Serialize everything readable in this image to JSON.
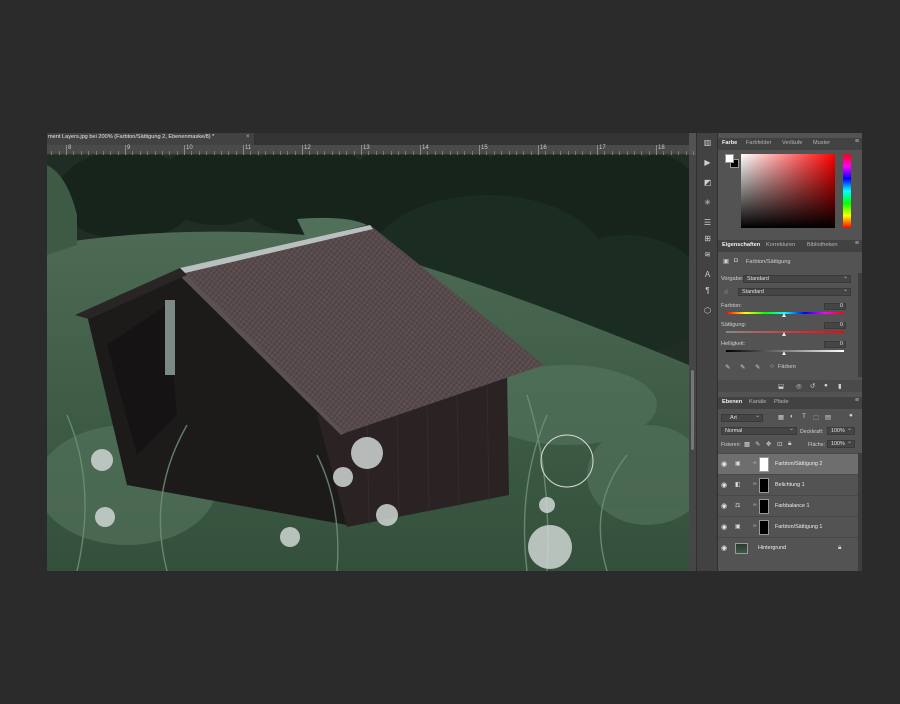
{
  "document": {
    "tab_title": "ment Layers.jpg bei 200% (Farbton/Sättigung 2, Ebenenmaske/8) *",
    "close_glyph": "×"
  },
  "ruler": {
    "numbers": [
      "8",
      "9",
      "10",
      "11",
      "12",
      "13",
      "14",
      "15",
      "16",
      "17",
      "18"
    ]
  },
  "color_panel": {
    "tabs": [
      "Farbe",
      "Farbfelder",
      "Verläufe",
      "Muster"
    ],
    "active_tab": "Farbe",
    "foreground": "#ffffff",
    "background": "#000000"
  },
  "properties_panel": {
    "tabs": [
      "Eigenschaften",
      "Korrekturen",
      "Bibliotheken"
    ],
    "active_tab": "Eigenschaften",
    "header": "Farbton/Sättigung",
    "preset_label": "Vorgabe:",
    "preset_value": "Standard",
    "channel_value": "Standard",
    "hue_label": "Farbton:",
    "hue_value": "0",
    "saturation_label": "Sättigung:",
    "saturation_value": "0",
    "lightness_label": "Helligkeit:",
    "lightness_value": "0",
    "colorize_label": "Färben"
  },
  "layers_panel": {
    "tabs": [
      "Ebenen",
      "Kanäle",
      "Pfade"
    ],
    "active_tab": "Ebenen",
    "filter_value": "Art",
    "blend_mode": "Normal",
    "opacity_label": "Deckkraft:",
    "opacity_value": "100%",
    "lock_label": "Fixieren:",
    "fill_label": "Fläche:",
    "fill_value": "100%",
    "layers": [
      {
        "name": "Farbton/Sättigung 2",
        "selected": true
      },
      {
        "name": "Belichtung 1",
        "selected": false
      },
      {
        "name": "Farbbalance 1",
        "selected": false
      },
      {
        "name": "Farbton/Sättigung 1",
        "selected": false
      },
      {
        "name": "Hintergrund",
        "selected": false
      }
    ]
  },
  "icons": {
    "eye": "eye-icon",
    "chain": "link-icon",
    "lock": "lock-icon",
    "menu": "panel-menu-icon"
  }
}
